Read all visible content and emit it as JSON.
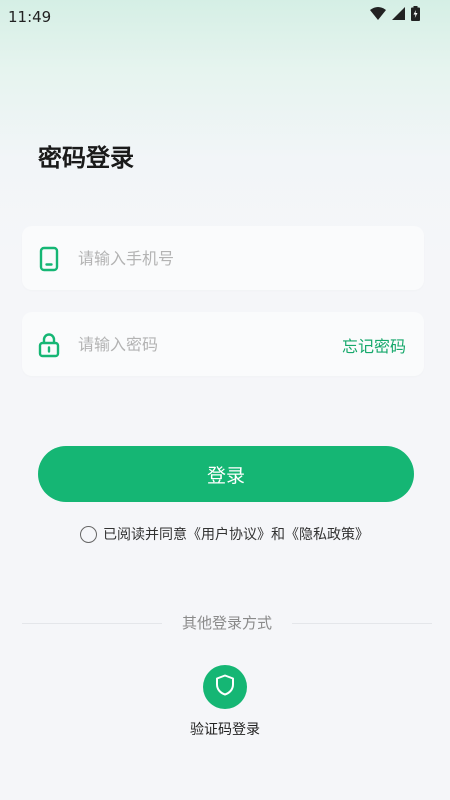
{
  "status_bar": {
    "time": "11:49",
    "icons": [
      "wifi-icon",
      "signal-icon",
      "battery-icon"
    ]
  },
  "page": {
    "title": "密码登录"
  },
  "form": {
    "phone_placeholder": "请输入手机号",
    "phone_icon": "phone-icon",
    "password_placeholder": "请输入密码",
    "password_icon": "lock-icon",
    "forgot_label": "忘记密码"
  },
  "login_button": {
    "label": "登录"
  },
  "agreement": {
    "prefix": "已阅读并同意",
    "user_agreement": "《用户协议》",
    "conjunction": "和",
    "privacy_policy": "《隐私政策》",
    "checked": false
  },
  "other_login": {
    "divider_label": "其他登录方式",
    "sms_label": "验证码登录",
    "sms_icon": "shield-icon"
  },
  "colors": {
    "accent": "#15b674",
    "link": "#16a86b",
    "placeholder": "#b3b3b3"
  }
}
